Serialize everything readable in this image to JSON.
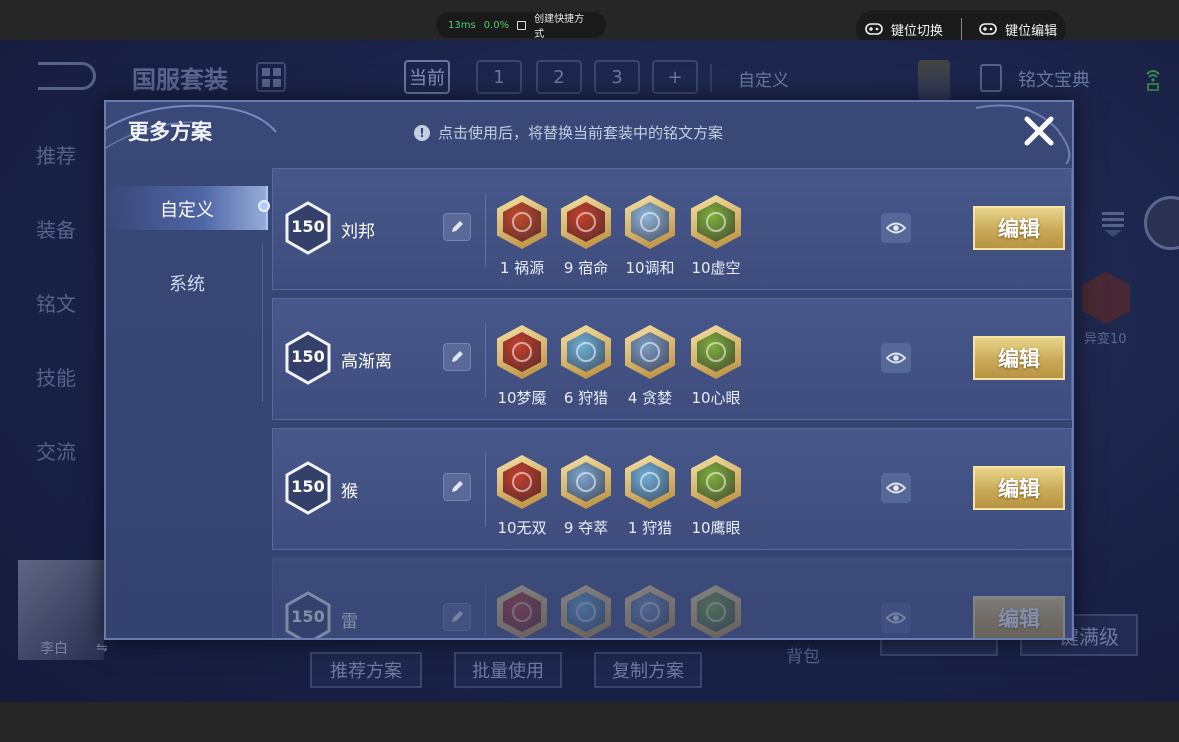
{
  "overlay": {
    "latency": "13ms",
    "loss": "0.0%",
    "shortcut_label": "创建快捷方式",
    "key_switch": "键位切换",
    "key_edit": "键位编辑"
  },
  "background": {
    "title": "国服套装",
    "tabs": [
      "当前",
      "1",
      "2",
      "3",
      "+"
    ],
    "custom_label": "自定义",
    "codex_label": "铭文宝典",
    "side_menu": [
      "推荐",
      "装备",
      "铭文",
      "技能",
      "交流"
    ],
    "hero_name": "李白",
    "bottom_buttons": [
      "推荐方案",
      "批量使用",
      "复制方案"
    ],
    "bag_label": "背包",
    "right_buttons": [
      "一键满级"
    ],
    "right_gem_label": "异变10"
  },
  "modal": {
    "title": "更多方案",
    "hint": "点击使用后，将替换当前套装中的铭文方案",
    "categories": [
      "自定义",
      "系统"
    ],
    "edit_label": "编辑",
    "rows": [
      {
        "level": "150",
        "name": "刘邦",
        "runes": [
          {
            "label": "1 祸源",
            "color": "#c24a2a"
          },
          {
            "label": "9 宿命",
            "color": "#c4402a"
          },
          {
            "label": "10调和",
            "color": "#8fb6d8"
          },
          {
            "label": "10虚空",
            "color": "#7fae3a"
          }
        ]
      },
      {
        "level": "150",
        "name": "高渐离",
        "runes": [
          {
            "label": "10梦魇",
            "color": "#c4402a"
          },
          {
            "label": "6 狩猎",
            "color": "#6fb0d6"
          },
          {
            "label": "4 贪婪",
            "color": "#7c9cc4"
          },
          {
            "label": "10心眼",
            "color": "#7fae3a"
          }
        ]
      },
      {
        "level": "150",
        "name": "猴",
        "runes": [
          {
            "label": "10无双",
            "color": "#c4402a"
          },
          {
            "label": "9 夺萃",
            "color": "#7ca6cc"
          },
          {
            "label": "1 狩猎",
            "color": "#6fb0d6"
          },
          {
            "label": "10鹰眼",
            "color": "#7fae3a"
          }
        ]
      },
      {
        "level": "150",
        "name": "雷",
        "runes": [
          {
            "label": "",
            "color": "#c4402a"
          },
          {
            "label": "",
            "color": "#6fb0d6"
          },
          {
            "label": "",
            "color": "#7c9cc4"
          },
          {
            "label": "",
            "color": "#7fae3a"
          }
        ]
      }
    ]
  }
}
